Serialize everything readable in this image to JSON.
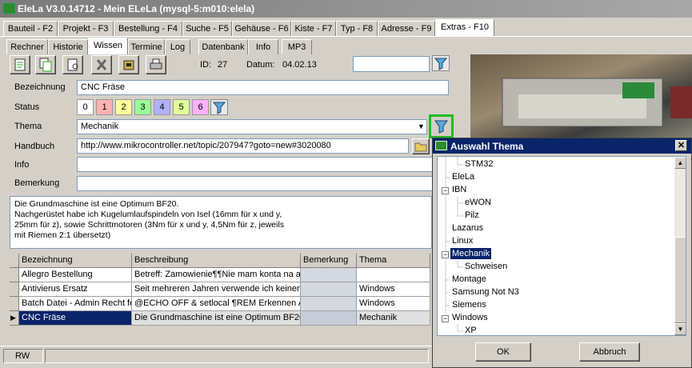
{
  "window": {
    "title": "EleLa V3.0.14712  -  Mein ELeLa (mysql-5:m010:elela)"
  },
  "main_tabs": [
    "Bauteil - F2",
    "Projekt - F3",
    "Bestellung - F4",
    "Suche - F5",
    "Gehäuse - F6",
    "Kiste - F7",
    "Typ - F8",
    "Adresse - F9",
    "Extras - F10"
  ],
  "sub_tabs": [
    "Rechner",
    "Historie",
    "Wissen",
    "Termine",
    "Log",
    "Datenbank",
    "Info",
    "MP3"
  ],
  "toolbar": {
    "id_label": "ID:",
    "id_value": "27",
    "date_label": "Datum:",
    "date_value": "04.02.13",
    "search_value": ""
  },
  "form": {
    "bezeichnung_label": "Bezeichnung",
    "bezeichnung_value": "CNC Fräse",
    "status_label": "Status",
    "status_values": [
      "0",
      "1",
      "2",
      "3",
      "4",
      "5",
      "6"
    ],
    "thema_label": "Thema",
    "thema_value": "Mechanik",
    "handbuch_label": "Handbuch",
    "handbuch_value": "http://www.mikrocontroller.net/topic/207947?goto=new#3020080",
    "info_label": "Info",
    "info_value": "",
    "bemerkung_label": "Bemerkung",
    "bemerkung_value": ""
  },
  "memo": [
    "Die Grundmaschine ist eine Optimum BF20.",
    "Nachgerüstet habe ich Kugelumlaufspindeln von Isel (16mm für x und y,",
    "25mm für z), sowie Schrittmotoren (3Nm für x und y, 4,5Nm für z, jeweils",
    "mit Riemen 2:1 übersetzt)"
  ],
  "table": {
    "columns": [
      "Bezeichnung",
      "Beschreibung",
      "Bemerkung",
      "Thema"
    ],
    "rows": [
      [
        "Allegro Bestellung",
        "Betreff: Zamowienie¶¶Nie mam konta na al",
        "",
        ""
      ],
      [
        "Antivierus Ersatz",
        "Seit mehreren Jahren verwende ich keinen",
        "",
        "Windows"
      ],
      [
        "Batch Datei - Admin Recht fe",
        "@ECHO OFF & setlocal ¶REM Erkennen Ad",
        "",
        "Windows"
      ],
      [
        "CNC Fräse",
        "Die Grundmaschine ist eine Optimum BF20.",
        "",
        "Mechanik"
      ]
    ]
  },
  "statusbar": {
    "mode": "RW"
  },
  "dialog": {
    "title": "Auswahl Thema",
    "tree": [
      {
        "label": "STM32",
        "level": 1
      },
      {
        "label": "EleLa",
        "level": 0
      },
      {
        "label": "IBN",
        "level": 0,
        "expandable": true
      },
      {
        "label": "eWON",
        "level": 1
      },
      {
        "label": "Pilz",
        "level": 1
      },
      {
        "label": "Lazarus",
        "level": 0
      },
      {
        "label": "Linux",
        "level": 0
      },
      {
        "label": "Mechanik",
        "level": 0,
        "expandable": true,
        "selected": true
      },
      {
        "label": "Schweisen",
        "level": 1
      },
      {
        "label": "Montage",
        "level": 0
      },
      {
        "label": "Samsung Not N3",
        "level": 0
      },
      {
        "label": "Siemens",
        "level": 0
      },
      {
        "label": "Windows",
        "level": 0,
        "expandable": true
      },
      {
        "label": "XP",
        "level": 1
      }
    ],
    "ok_label": "OK",
    "cancel_label": "Abbruch"
  },
  "colors": {
    "selection": "#0a246a",
    "highlight_border": "#22bb22",
    "status_colors": [
      "#ffffff",
      "#ffb0b0",
      "#ffff99",
      "#99ff99",
      "#b0b0ff",
      "#e0ff99",
      "#ffb0ff"
    ]
  }
}
